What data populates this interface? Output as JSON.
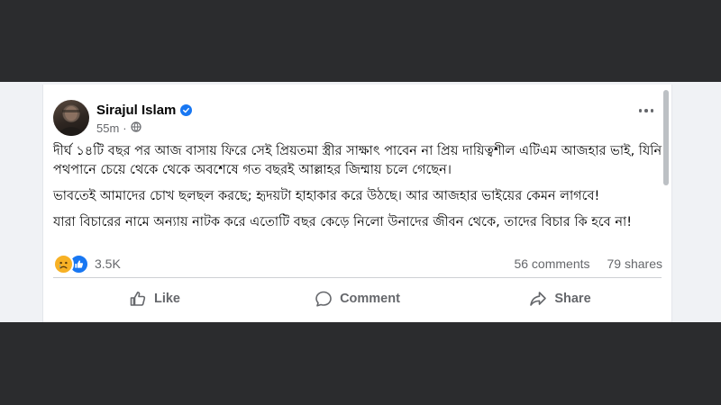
{
  "post": {
    "author": "Sirajul Islam",
    "time": "55m",
    "paragraphs": [
      "দীর্ঘ ১৪টি বছর পর আজ বাসায় ফিরে সেই প্রিয়তমা স্ত্রীর সাক্ষাৎ পাবেন না প্রিয় দায়িত্বশীল এটিএম আজহার ভাই, যিনি পথপানে চেয়ে থেকে থেকে অবশেষে গত বছরই আল্লাহর জিম্মায় চলে গেছেন।",
      "ভাবতেই আমাদের চোখ ছলছল করছে; হৃদয়টা হাহাকার করে উঠছে। আর আজহার ভাইয়ের কেমন লাগবে!",
      "যারা বিচারের নামে অন্যায় নাটক করে এতোটি বছর কেড়ে নিলো উনাদের জীবন থেকে, তাদের বিচার কি হবে না!"
    ],
    "reactions_count": "3.5K",
    "comments": "56 comments",
    "shares": "79 shares"
  },
  "actions": {
    "like": "Like",
    "comment": "Comment",
    "share": "Share"
  },
  "colors": {
    "accent": "#1877f2",
    "text": "#050505",
    "muted": "#65676b",
    "sad": "#f7b125"
  },
  "icons": [
    "verified-badge-icon",
    "globe-icon",
    "more-options-icon",
    "sad-reaction-icon",
    "like-reaction-icon",
    "like-icon",
    "comment-icon",
    "share-icon"
  ]
}
